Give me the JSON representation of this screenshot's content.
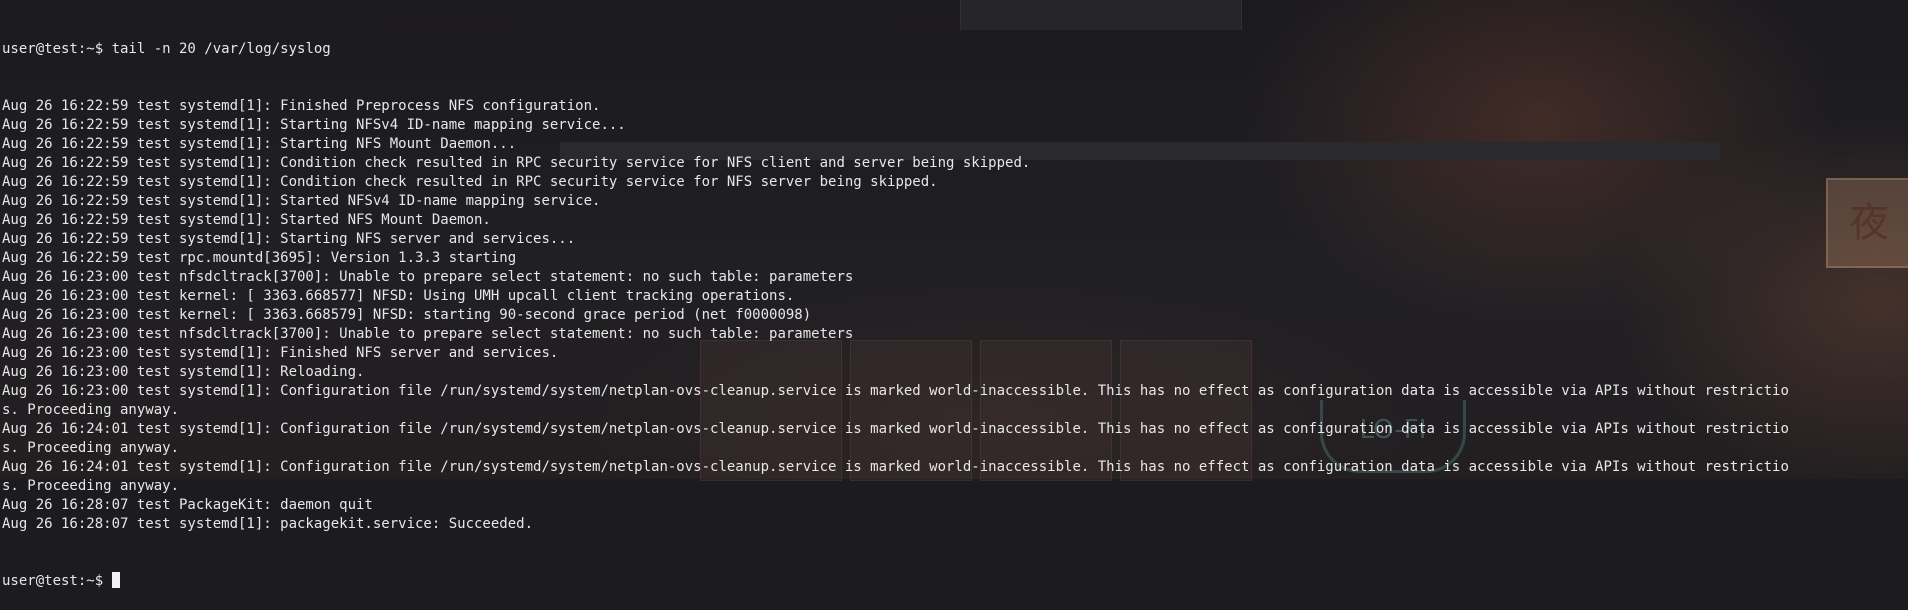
{
  "terminal": {
    "prompt": "user@test:~$ ",
    "command": "tail -n 20 /var/log/syslog",
    "output_lines": [
      "Aug 26 16:22:59 test systemd[1]: Finished Preprocess NFS configuration.",
      "Aug 26 16:22:59 test systemd[1]: Starting NFSv4 ID-name mapping service...",
      "Aug 26 16:22:59 test systemd[1]: Starting NFS Mount Daemon...",
      "Aug 26 16:22:59 test systemd[1]: Condition check resulted in RPC security service for NFS client and server being skipped.",
      "Aug 26 16:22:59 test systemd[1]: Condition check resulted in RPC security service for NFS server being skipped.",
      "Aug 26 16:22:59 test systemd[1]: Started NFSv4 ID-name mapping service.",
      "Aug 26 16:22:59 test systemd[1]: Started NFS Mount Daemon.",
      "Aug 26 16:22:59 test systemd[1]: Starting NFS server and services...",
      "Aug 26 16:22:59 test rpc.mountd[3695]: Version 1.3.3 starting",
      "Aug 26 16:23:00 test nfsdcltrack[3700]: Unable to prepare select statement: no such table: parameters",
      "Aug 26 16:23:00 test kernel: [ 3363.668577] NFSD: Using UMH upcall client tracking operations.",
      "Aug 26 16:23:00 test kernel: [ 3363.668579] NFSD: starting 90-second grace period (net f0000098)",
      "Aug 26 16:23:00 test nfsdcltrack[3700]: Unable to prepare select statement: no such table: parameters",
      "Aug 26 16:23:00 test systemd[1]: Finished NFS server and services.",
      "Aug 26 16:23:00 test systemd[1]: Reloading.",
      "Aug 26 16:23:00 test systemd[1]: Configuration file /run/systemd/system/netplan-ovs-cleanup.service is marked world-inaccessible. This has no effect as configuration data is accessible via APIs without restrictio",
      "s. Proceeding anyway.",
      "Aug 26 16:24:01 test systemd[1]: Configuration file /run/systemd/system/netplan-ovs-cleanup.service is marked world-inaccessible. This has no effect as configuration data is accessible via APIs without restrictio",
      "s. Proceeding anyway.",
      "Aug 26 16:24:01 test systemd[1]: Configuration file /run/systemd/system/netplan-ovs-cleanup.service is marked world-inaccessible. This has no effect as configuration data is accessible via APIs without restrictio",
      "s. Proceeding anyway.",
      "Aug 26 16:28:07 test PackageKit: daemon quit",
      "Aug 26 16:28:07 test systemd[1]: packagekit.service: Succeeded."
    ],
    "final_prompt": "user@test:~$ "
  },
  "background": {
    "sign_text": "夜",
    "cup_text": "LO-FI"
  },
  "colors": {
    "terminal_text": "#e7e7e7",
    "background": "#1c1b1f",
    "cursor": "#f2f2f2"
  }
}
